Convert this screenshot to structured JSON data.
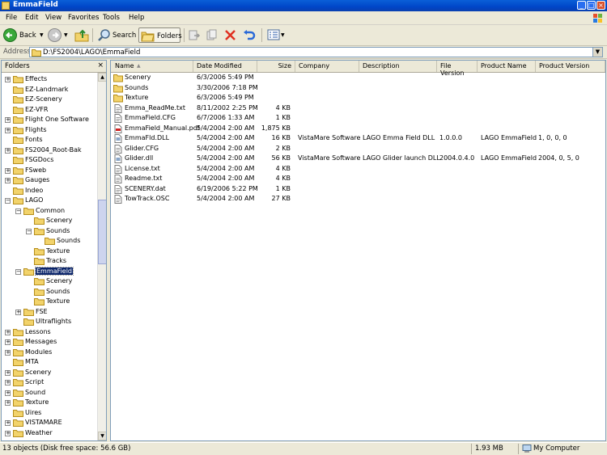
{
  "window": {
    "title": "EmmaField"
  },
  "menu": {
    "items": [
      {
        "label": "File"
      },
      {
        "label": "Edit"
      },
      {
        "label": "View"
      },
      {
        "label": "Favorites"
      },
      {
        "label": "Tools"
      },
      {
        "label": "Help"
      }
    ]
  },
  "toolbar": {
    "back_label": "Back",
    "search_label": "Search",
    "folders_label": "Folders"
  },
  "address": {
    "label": "Address",
    "path": "D:\\FS2004\\LAGO\\EmmaField"
  },
  "folders": {
    "title": "Folders",
    "tree": [
      {
        "label": "Effects",
        "expander": "+",
        "icon": "folder"
      },
      {
        "label": "EZ-Landmark",
        "expander": "",
        "icon": "folder"
      },
      {
        "label": "EZ-Scenery",
        "expander": "",
        "icon": "folder"
      },
      {
        "label": "EZ-VFR",
        "expander": "",
        "icon": "folder"
      },
      {
        "label": "Flight One Software",
        "expander": "+",
        "icon": "folder"
      },
      {
        "label": "Flights",
        "expander": "+",
        "icon": "folder"
      },
      {
        "label": "Fonts",
        "expander": "",
        "icon": "folder"
      },
      {
        "label": "FS2004_Root-Bak",
        "expander": "+",
        "icon": "folder"
      },
      {
        "label": "FSGDocs",
        "expander": "",
        "icon": "folder"
      },
      {
        "label": "FSweb",
        "expander": "+",
        "icon": "folder"
      },
      {
        "label": "Gauges",
        "expander": "+",
        "icon": "folder"
      },
      {
        "label": "Indeo",
        "expander": "",
        "icon": "folder"
      },
      {
        "label": "LAGO",
        "expander": "−",
        "icon": "folder"
      },
      {
        "label": "Common",
        "expander": "−",
        "icon": "folder"
      },
      {
        "label": "Scenery",
        "expander": "",
        "icon": "folder"
      },
      {
        "label": "Sounds",
        "expander": "−",
        "icon": "folder"
      },
      {
        "label": "Sounds",
        "expander": "",
        "icon": "folder"
      },
      {
        "label": "Texture",
        "expander": "",
        "icon": "folder"
      },
      {
        "label": "Tracks",
        "expander": "",
        "icon": "folder"
      },
      {
        "label": "EmmaField",
        "expander": "−",
        "icon": "folder-open",
        "selected": true
      },
      {
        "label": "Scenery",
        "expander": "",
        "icon": "folder"
      },
      {
        "label": "Sounds",
        "expander": "",
        "icon": "folder"
      },
      {
        "label": "Texture",
        "expander": "",
        "icon": "folder"
      },
      {
        "label": "FSE",
        "expander": "+",
        "icon": "folder"
      },
      {
        "label": "Ultraflights",
        "expander": "",
        "icon": "folder"
      },
      {
        "label": "Lessons",
        "expander": "+",
        "icon": "folder"
      },
      {
        "label": "Messages",
        "expander": "+",
        "icon": "folder"
      },
      {
        "label": "Modules",
        "expander": "+",
        "icon": "folder"
      },
      {
        "label": "MTA",
        "expander": "",
        "icon": "folder"
      },
      {
        "label": "Scenery",
        "expander": "+",
        "icon": "folder"
      },
      {
        "label": "Script",
        "expander": "+",
        "icon": "folder"
      },
      {
        "label": "Sound",
        "expander": "+",
        "icon": "folder"
      },
      {
        "label": "Texture",
        "expander": "+",
        "icon": "folder"
      },
      {
        "label": "Uires",
        "expander": "",
        "icon": "folder"
      },
      {
        "label": "VISTAMARE",
        "expander": "+",
        "icon": "folder"
      },
      {
        "label": "Weather",
        "expander": "+",
        "icon": "folder"
      }
    ]
  },
  "files": {
    "columns": [
      "Name",
      "Date Modified",
      "Size",
      "Company",
      "Description",
      "File Version",
      "Product Name",
      "Product Version"
    ],
    "rows": [
      {
        "name": "Scenery",
        "date": "6/3/2006 5:49 PM",
        "size": "",
        "company": "",
        "description": "",
        "file_version": "",
        "product_name": "",
        "product_version": "",
        "icon": "folder"
      },
      {
        "name": "Sounds",
        "date": "3/30/2006 7:18 PM",
        "size": "",
        "company": "",
        "description": "",
        "file_version": "",
        "product_name": "",
        "product_version": "",
        "icon": "folder"
      },
      {
        "name": "Texture",
        "date": "6/3/2006 5:49 PM",
        "size": "",
        "company": "",
        "description": "",
        "file_version": "",
        "product_name": "",
        "product_version": "",
        "icon": "folder"
      },
      {
        "name": "Emma_ReadMe.txt",
        "date": "8/11/2002 2:25 PM",
        "size": "4 KB",
        "company": "",
        "description": "",
        "file_version": "",
        "product_name": "",
        "product_version": "",
        "icon": "text"
      },
      {
        "name": "EmmaField.CFG",
        "date": "6/7/2006 1:33 AM",
        "size": "1 KB",
        "company": "",
        "description": "",
        "file_version": "",
        "product_name": "",
        "product_version": "",
        "icon": "text"
      },
      {
        "name": "EmmaField_Manual.pdf",
        "date": "5/4/2004 2:00 AM",
        "size": "1,875 KB",
        "company": "",
        "description": "",
        "file_version": "",
        "product_name": "",
        "product_version": "",
        "icon": "pdf"
      },
      {
        "name": "EmmaFld.DLL",
        "date": "5/4/2004 2:00 AM",
        "size": "16 KB",
        "company": "VistaMare Software",
        "description": "LAGO Emma Field DLL",
        "file_version": "1.0.0.0",
        "product_name": "LAGO EmmaField",
        "product_version": "1, 0, 0, 0",
        "icon": "dll"
      },
      {
        "name": "Glider.CFG",
        "date": "5/4/2004 2:00 AM",
        "size": "2 KB",
        "company": "",
        "description": "",
        "file_version": "",
        "product_name": "",
        "product_version": "",
        "icon": "text"
      },
      {
        "name": "Glider.dll",
        "date": "5/4/2004 2:00 AM",
        "size": "56 KB",
        "company": "VistaMare Software",
        "description": "LAGO Glider launch DLL",
        "file_version": "2004.0.4.0",
        "product_name": "LAGO EmmaField",
        "product_version": "2004, 0, 5, 0",
        "icon": "dll"
      },
      {
        "name": "License.txt",
        "date": "5/4/2004 2:00 AM",
        "size": "4 KB",
        "company": "",
        "description": "",
        "file_version": "",
        "product_name": "",
        "product_version": "",
        "icon": "text"
      },
      {
        "name": "Readme.txt",
        "date": "5/4/2004 2:00 AM",
        "size": "4 KB",
        "company": "",
        "description": "",
        "file_version": "",
        "product_name": "",
        "product_version": "",
        "icon": "text"
      },
      {
        "name": "SCENERY.dat",
        "date": "6/19/2006 5:22 PM",
        "size": "1 KB",
        "company": "",
        "description": "",
        "file_version": "",
        "product_name": "",
        "product_version": "",
        "icon": "text"
      },
      {
        "name": "TowTrack.OSC",
        "date": "5/4/2004 2:00 AM",
        "size": "27 KB",
        "company": "",
        "description": "",
        "file_version": "",
        "product_name": "",
        "product_version": "",
        "icon": "text"
      }
    ]
  },
  "status": {
    "summary": "13 objects (Disk free space: 56.6 GB)",
    "size": "1.93 MB",
    "location": "My Computer"
  },
  "colors": {
    "title_bar": "#0046c8",
    "selection": "#0a246a",
    "folder": "#f2d36b"
  }
}
